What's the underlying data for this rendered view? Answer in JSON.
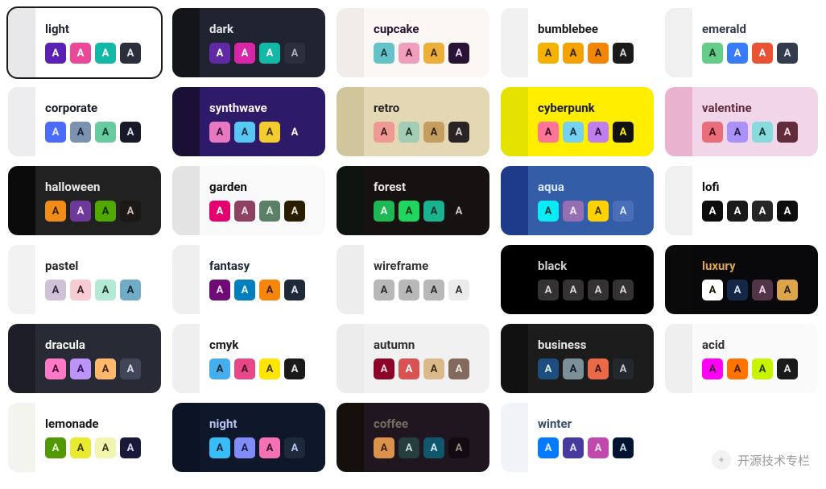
{
  "swatch_letter": "A",
  "watermark": {
    "label": "开源技术专栏"
  },
  "themes": [
    {
      "name": "light",
      "selected": true,
      "edge": "#e8e8ea",
      "bg": "#ffffff",
      "fg": "#1f2430",
      "sw": [
        [
          "#5b21b6",
          "#ffffff"
        ],
        [
          "#ec4899",
          "#ffffff"
        ],
        [
          "#14b8a6",
          "#ffffff"
        ],
        [
          "#2a2f3b",
          "#e5e7eb"
        ]
      ]
    },
    {
      "name": "dark",
      "edge": "#13151b",
      "bg": "#1f2430",
      "fg": "#e3e4e8",
      "sw": [
        [
          "#6029a6",
          "#ffffff"
        ],
        [
          "#d926a9",
          "#ffffff"
        ],
        [
          "#14b8a6",
          "#ffffff"
        ],
        [
          "#2a2f3b",
          "#a6adbb"
        ]
      ]
    },
    {
      "name": "cupcake",
      "edge": "#efecea",
      "bg": "#faf7f5",
      "fg": "#291334",
      "sw": [
        [
          "#65c3c8",
          "#1b3b46"
        ],
        [
          "#ef9fbc",
          "#4a1830"
        ],
        [
          "#eeaf3a",
          "#3f2a07"
        ],
        [
          "#291334",
          "#f3d9ff"
        ]
      ]
    },
    {
      "name": "bumblebee",
      "edge": "#f1f1f1",
      "bg": "#ffffff",
      "fg": "#1a1a1a",
      "sw": [
        [
          "#f5b300",
          "#3b2a00"
        ],
        [
          "#f4a200",
          "#3b2300"
        ],
        [
          "#f28705",
          "#3b1e00"
        ],
        [
          "#1a1a1a",
          "#d6d6d6"
        ]
      ]
    },
    {
      "name": "emerald",
      "edge": "#f0f0f0",
      "bg": "#ffffff",
      "fg": "#333c4d",
      "sw": [
        [
          "#66cc8a",
          "#163a22"
        ],
        [
          "#377cfb",
          "#ffffff"
        ],
        [
          "#ea5234",
          "#ffffff"
        ],
        [
          "#333c4d",
          "#e4e6ea"
        ]
      ]
    },
    {
      "name": "corporate",
      "edge": "#ededef",
      "bg": "#ffffff",
      "fg": "#181a2a",
      "sw": [
        [
          "#4b6bfb",
          "#e9edff"
        ],
        [
          "#7b92b2",
          "#1b2633"
        ],
        [
          "#67cba0",
          "#13382a"
        ],
        [
          "#181a2a",
          "#dadce4"
        ]
      ]
    },
    {
      "name": "synthwave",
      "edge": "#1a0f35",
      "bg": "#2d1b69",
      "fg": "#f9f7fd",
      "sw": [
        [
          "#e779c1",
          "#3a0f2d"
        ],
        [
          "#58c7f3",
          "#0e2f3e"
        ],
        [
          "#f3cc30",
          "#3f3305"
        ],
        [
          "#2d1b69",
          "#f9f7fd"
        ]
      ]
    },
    {
      "name": "retro",
      "edge": "#d1c59b",
      "bg": "#e4d8b4",
      "fg": "#282425",
      "sw": [
        [
          "#ef9995",
          "#3a1f1e"
        ],
        [
          "#a4cbb4",
          "#22352b"
        ],
        [
          "#c59d5f",
          "#2e2212"
        ],
        [
          "#282425",
          "#d8d2c7"
        ]
      ]
    },
    {
      "name": "cyberpunk",
      "edge": "#e5e100",
      "bg": "#ffee00",
      "fg": "#1a1a1a",
      "sw": [
        [
          "#ff7598",
          "#3f0e1f"
        ],
        [
          "#75d1f0",
          "#0e3340"
        ],
        [
          "#c07eec",
          "#2a1340"
        ],
        [
          "#111111",
          "#ffee00"
        ]
      ]
    },
    {
      "name": "valentine",
      "edge": "#e9b3d0",
      "bg": "#f0d6e8",
      "fg": "#632c3b",
      "sw": [
        [
          "#e96d7b",
          "#4a1018"
        ],
        [
          "#a991f7",
          "#2a1d4a"
        ],
        [
          "#88dbdd",
          "#123839"
        ],
        [
          "#632c3b",
          "#f3dbe3"
        ]
      ]
    },
    {
      "name": "halloween",
      "edge": "#0b0b0b",
      "bg": "#212121",
      "fg": "#e8e8e8",
      "sw": [
        [
          "#f28c18",
          "#3a1e00"
        ],
        [
          "#6d3a9c",
          "#efe4fb"
        ],
        [
          "#51a800",
          "#102600"
        ],
        [
          "#1b1816",
          "#c7bfb6"
        ]
      ]
    },
    {
      "name": "garden",
      "edge": "#e3e3e3",
      "bg": "#f9f9f9",
      "fg": "#100f0f",
      "sw": [
        [
          "#e5006f",
          "#ffffff"
        ],
        [
          "#8e4162",
          "#f9e1ec"
        ],
        [
          "#5c7f67",
          "#e2ece5"
        ],
        [
          "#291e00",
          "#e7e1cf"
        ]
      ]
    },
    {
      "name": "forest",
      "edge": "#0e1510",
      "bg": "#171212",
      "fg": "#e7e7e7",
      "sw": [
        [
          "#1eb854",
          "#e6fbef"
        ],
        [
          "#1fd65f",
          "#073315"
        ],
        [
          "#19b38f",
          "#063127"
        ],
        [
          "#171212",
          "#cfc9c9"
        ]
      ]
    },
    {
      "name": "aqua",
      "edge": "#1e3a8a",
      "bg": "#345da7",
      "fg": "#dbe7ff",
      "sw": [
        [
          "#09ecf3",
          "#013338"
        ],
        [
          "#966fb3",
          "#f0e7fb"
        ],
        [
          "#ffd200",
          "#3f3300"
        ],
        [
          "#4a6fb8",
          "#dbe7ff"
        ]
      ]
    },
    {
      "name": "lofi",
      "edge": "#f0f0f0",
      "bg": "#ffffff",
      "fg": "#0d0d0d",
      "sw": [
        [
          "#0d0d0d",
          "#ffffff"
        ],
        [
          "#1a1a1a",
          "#ffffff"
        ],
        [
          "#262626",
          "#ffffff"
        ],
        [
          "#0d0d0d",
          "#ffffff"
        ]
      ]
    },
    {
      "name": "pastel",
      "edge": "#f2f2f3",
      "bg": "#ffffff",
      "fg": "#27272a",
      "sw": [
        [
          "#d1c1d7",
          "#322a36"
        ],
        [
          "#f6cbd1",
          "#3d2025"
        ],
        [
          "#b4e9d6",
          "#1f3a30"
        ],
        [
          "#70acc7",
          "#0f2833"
        ]
      ]
    },
    {
      "name": "fantasy",
      "edge": "#efefef",
      "bg": "#ffffff",
      "fg": "#1f2937",
      "sw": [
        [
          "#6e0b75",
          "#f6ddf8"
        ],
        [
          "#007ebd",
          "#e3f3fd"
        ],
        [
          "#f8860d",
          "#3c1f00"
        ],
        [
          "#1f2937",
          "#e5e7eb"
        ]
      ]
    },
    {
      "name": "wireframe",
      "edge": "#ededed",
      "bg": "#ffffff",
      "fg": "#333333",
      "sw": [
        [
          "#b8b8b8",
          "#2b2b2b"
        ],
        [
          "#b8b8b8",
          "#2b2b2b"
        ],
        [
          "#b8b8b8",
          "#2b2b2b"
        ],
        [
          "#ebebeb",
          "#333333"
        ]
      ]
    },
    {
      "name": "black",
      "edge": "#000000",
      "bg": "#000000",
      "fg": "#cccccc",
      "sw": [
        [
          "#343232",
          "#d6d4d4"
        ],
        [
          "#343232",
          "#d6d4d4"
        ],
        [
          "#343232",
          "#d6d4d4"
        ],
        [
          "#343232",
          "#d6d4d4"
        ]
      ]
    },
    {
      "name": "luxury",
      "edge": "#0a0a0a",
      "bg": "#09090b",
      "fg": "#dca54c",
      "sw": [
        [
          "#ffffff",
          "#1a1300"
        ],
        [
          "#152747",
          "#d9e4f5"
        ],
        [
          "#513448",
          "#f0d9eb"
        ],
        [
          "#dca54c",
          "#2a1d04"
        ]
      ]
    },
    {
      "name": "dracula",
      "edge": "#1d1e27",
      "bg": "#282a36",
      "fg": "#f8f8f2",
      "sw": [
        [
          "#ff79c6",
          "#470e2e"
        ],
        [
          "#bd93f9",
          "#2a1650"
        ],
        [
          "#ffb86c",
          "#3e2408"
        ],
        [
          "#414558",
          "#dcdde6"
        ]
      ]
    },
    {
      "name": "cmyk",
      "edge": "#efefef",
      "bg": "#ffffff",
      "fg": "#1a1a1a",
      "sw": [
        [
          "#45aeee",
          "#05222f"
        ],
        [
          "#e8488a",
          "#3d0a1f"
        ],
        [
          "#ffe500",
          "#3f3700"
        ],
        [
          "#1a1a1a",
          "#e6e6e6"
        ]
      ]
    },
    {
      "name": "autumn",
      "edge": "#ececec",
      "bg": "#f1f1f1",
      "fg": "#303030",
      "sw": [
        [
          "#8c0327",
          "#fbd8e1"
        ],
        [
          "#d85251",
          "#ffffff"
        ],
        [
          "#dcb98a",
          "#3a2a10"
        ],
        [
          "#826a5c",
          "#f2eae4"
        ]
      ]
    },
    {
      "name": "business",
      "edge": "#111111",
      "bg": "#1c1c1c",
      "fg": "#e5e5e5",
      "sw": [
        [
          "#1c4e80",
          "#e2ecf7"
        ],
        [
          "#7c909a",
          "#101b20"
        ],
        [
          "#ea6947",
          "#3a1407"
        ],
        [
          "#23282e",
          "#c7ccd1"
        ]
      ]
    },
    {
      "name": "acid",
      "edge": "#efefef",
      "bg": "#fafafa",
      "fg": "#333333",
      "sw": [
        [
          "#ff00f4",
          "#3f003c"
        ],
        [
          "#ff7400",
          "#3f1c00"
        ],
        [
          "#c7f400",
          "#2c3700"
        ],
        [
          "#1a1a1a",
          "#e6e6e6"
        ]
      ]
    },
    {
      "name": "lemonade",
      "edge": "#f4f4ee",
      "bg": "#ffffff",
      "fg": "#1a1a1a",
      "sw": [
        [
          "#519903",
          "#e9f8d7"
        ],
        [
          "#e9e92e",
          "#3c3c07"
        ],
        [
          "#f4f4b1",
          "#3a3a1f"
        ],
        [
          "#191a3a",
          "#d7d8ea"
        ]
      ]
    },
    {
      "name": "night",
      "edge": "#0b1324",
      "bg": "#0f172a",
      "fg": "#b4c6ef",
      "sw": [
        [
          "#38bdf8",
          "#042432"
        ],
        [
          "#818cf8",
          "#171d46"
        ],
        [
          "#f471b5",
          "#3d0b25"
        ],
        [
          "#1e293b",
          "#b4c6ef"
        ]
      ]
    },
    {
      "name": "coffee",
      "edge": "#15100b",
      "bg": "#20161f",
      "fg": "#746d63",
      "sw": [
        [
          "#db924b",
          "#3a2207"
        ],
        [
          "#263e3f",
          "#c7dbdc"
        ],
        [
          "#10576d",
          "#cfeaf3"
        ],
        [
          "#120c12",
          "#9c9086"
        ]
      ]
    },
    {
      "name": "winter",
      "edge": "#f1f3f9",
      "bg": "#ffffff",
      "fg": "#394e6a",
      "sw": [
        [
          "#047aff",
          "#e3f0ff"
        ],
        [
          "#463aa1",
          "#e4e1f7"
        ],
        [
          "#c148ac",
          "#f9e2f5"
        ],
        [
          "#021431",
          "#cfd8e7"
        ]
      ]
    }
  ]
}
